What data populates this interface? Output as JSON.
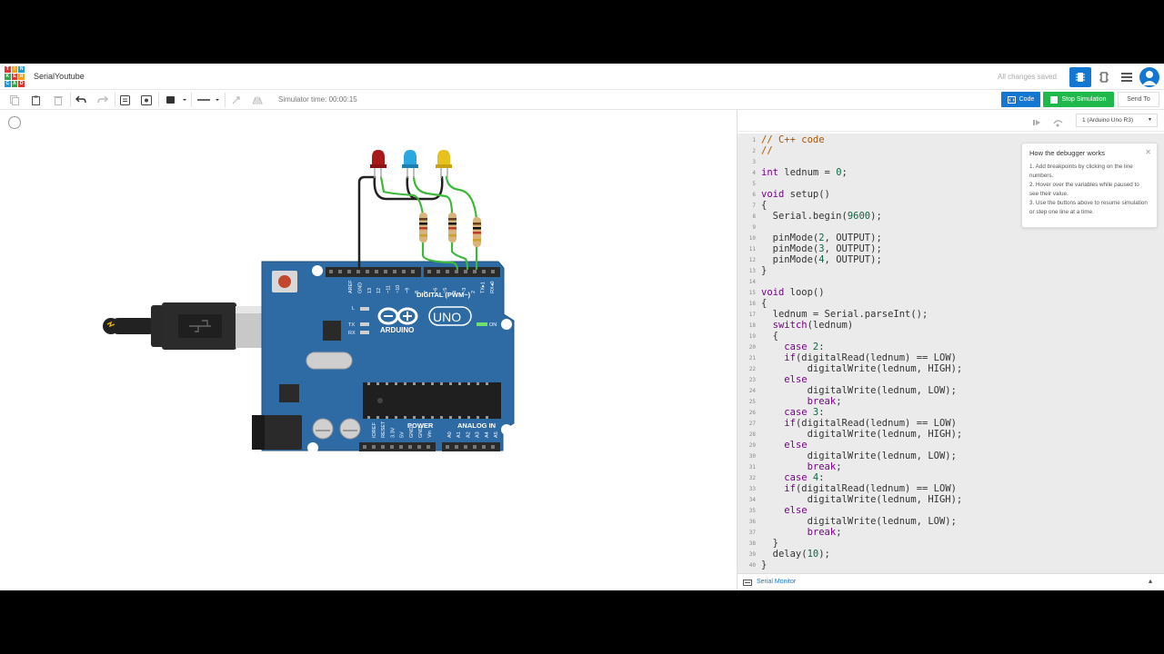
{
  "app": {
    "project_title": "SerialYoutube",
    "save_status": "All changes saved",
    "logo_letters": [
      "TIN",
      "KER",
      "CAD"
    ]
  },
  "toolbar": {
    "simulator_time": "Simulator time: 00:00:15",
    "code_label": "Code",
    "stop_label": "Stop Simulation",
    "sendto_label": "Send To"
  },
  "code_panel": {
    "board_select": "1 (Arduino Uno R3)",
    "serial_monitor": "Serial Monitor",
    "lines": [
      "// C++ code",
      "//",
      "",
      "int lednum = 0;",
      "",
      "void setup()",
      "{",
      "  Serial.begin(9600);",
      "",
      "  pinMode(2, OUTPUT);",
      "  pinMode(3, OUTPUT);",
      "  pinMode(4, OUTPUT);",
      "}",
      "",
      "void loop()",
      "{",
      "  lednum = Serial.parseInt();",
      "  switch(lednum)",
      "  {",
      "    case 2:",
      "    if(digitalRead(lednum) == LOW)",
      "        digitalWrite(lednum, HIGH);",
      "    else",
      "        digitalWrite(lednum, LOW);",
      "        break;",
      "    case 3:",
      "    if(digitalRead(lednum) == LOW)",
      "        digitalWrite(lednum, HIGH);",
      "    else",
      "        digitalWrite(lednum, LOW);",
      "        break;",
      "    case 4:",
      "    if(digitalRead(lednum) == LOW)",
      "        digitalWrite(lednum, HIGH);",
      "    else",
      "        digitalWrite(lednum, LOW);",
      "        break;",
      "  }",
      "  delay(10);",
      "}"
    ]
  },
  "debugger_tip": {
    "title": "How the debugger works",
    "items": [
      "1. Add breakpoints by clicking on the line numbers.",
      "2. Hover over the variables while paused to see their value.",
      "3. Use the buttons above to resume simulation or step one line at a time."
    ]
  },
  "board": {
    "brand": "ARDUINO",
    "model": "UNO",
    "digital_label": "DIGITAL (PWM~)",
    "power_label": "POWER",
    "analog_label": "ANALOG IN",
    "on_label": "ON",
    "led_labels": [
      "L",
      "TX",
      "RX"
    ],
    "digital_pins": [
      "AREF",
      "GND",
      "13",
      "12",
      "~11",
      "~10",
      "~9",
      "8",
      "7",
      "~6",
      "~5",
      "4",
      "~3",
      "2",
      "TX▸1",
      "RX◂0"
    ],
    "power_pins": [
      "IOREF",
      "RESET",
      "3.3V",
      "5V",
      "GND",
      "GND",
      "Vin"
    ],
    "analog_pins": [
      "A0",
      "A1",
      "A2",
      "A3",
      "A4",
      "A5"
    ]
  },
  "leds": [
    {
      "color": "red",
      "hex": "#b01515"
    },
    {
      "color": "blue",
      "hex": "#2aa7e0"
    },
    {
      "color": "yellow",
      "hex": "#e8c21c"
    }
  ],
  "colors": {
    "accent": "#1477d2",
    "stop_green": "#1fb84a",
    "board_blue": "#2e6aa3",
    "wire_green": "#3db83a"
  }
}
